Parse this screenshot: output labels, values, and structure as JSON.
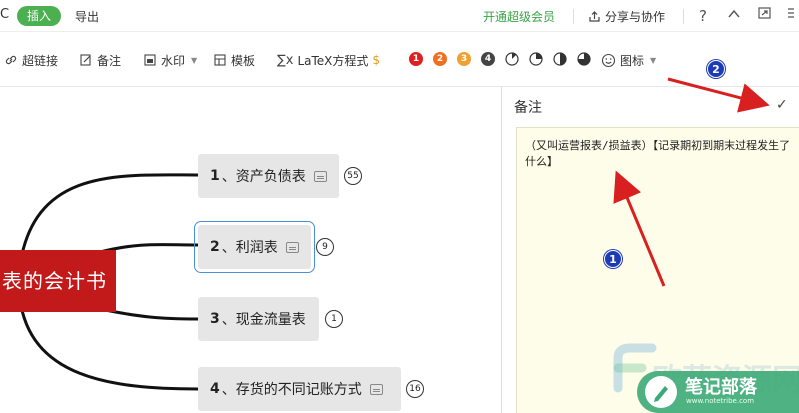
{
  "menubar": {
    "edge_char": "C",
    "insert_tab": "插入",
    "export_tab": "导出",
    "vip": "开通超级会员",
    "share": "分享与协作",
    "help": "?"
  },
  "toolbar": {
    "hyperlink": "超链接",
    "note": "备注",
    "watermark": "水印",
    "template": "模板",
    "latex": "LaTeX方程式",
    "latex_badge": "$",
    "priorities": [
      "1",
      "2",
      "3",
      "4"
    ],
    "priority_colors": [
      "#e02020",
      "#f07020",
      "#f0a030",
      "#444444"
    ],
    "progress_fractions": [
      0.125,
      0.25,
      0.5,
      0.75
    ],
    "icons": "图标"
  },
  "mindmap": {
    "central": "表的会计书",
    "nodes": [
      {
        "num": "1",
        "label": "、资产负债表",
        "count": "55"
      },
      {
        "num": "2",
        "label": "、利润表",
        "count": "9"
      },
      {
        "num": "3",
        "label": "、现金流量表",
        "count": "1"
      },
      {
        "num": "4",
        "label": "、存货的不同记账方式",
        "count": "16"
      }
    ]
  },
  "note_panel": {
    "title": "备注",
    "text": "（又叫运营报表/损益表）【记录期初到期末过程发生了什么】"
  },
  "annotations": {
    "marker1": "1",
    "marker2": "2",
    "arrow_color": "#d82020"
  },
  "watermark": {
    "site": "欧菲资源网",
    "brand": "笔记部落",
    "url": "www.notetribe.com"
  }
}
